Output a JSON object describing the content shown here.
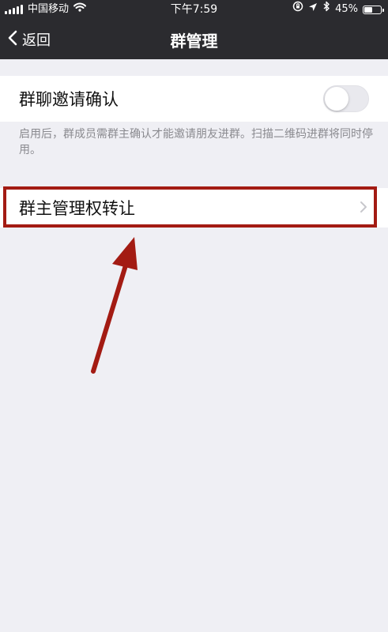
{
  "status_bar": {
    "carrier": "中国移动",
    "time": "下午7:59",
    "battery_percent": "45%",
    "battery_level": 0.45
  },
  "nav": {
    "back_label": "返回",
    "title": "群管理"
  },
  "settings": {
    "invite_confirm": {
      "label": "群聊邀请确认",
      "enabled": false
    },
    "invite_confirm_description": "启用后，群成员需群主确认才能邀请朋友进群。扫描二维码进群将同时停用。",
    "transfer_owner": {
      "label": "群主管理权转让"
    }
  },
  "colors": {
    "header_bg": "#2b2b2f",
    "page_bg": "#efeff4",
    "annotation_red": "#a31b13"
  },
  "icons": {
    "back": "chevron-left-icon",
    "row_arrow": "chevron-right-icon",
    "wifi": "wifi-icon",
    "signal": "signal-icon",
    "battery": "battery-icon",
    "location": "location-icon",
    "bluetooth": "bluetooth-icon",
    "orientation_lock": "orientation-lock-icon"
  }
}
